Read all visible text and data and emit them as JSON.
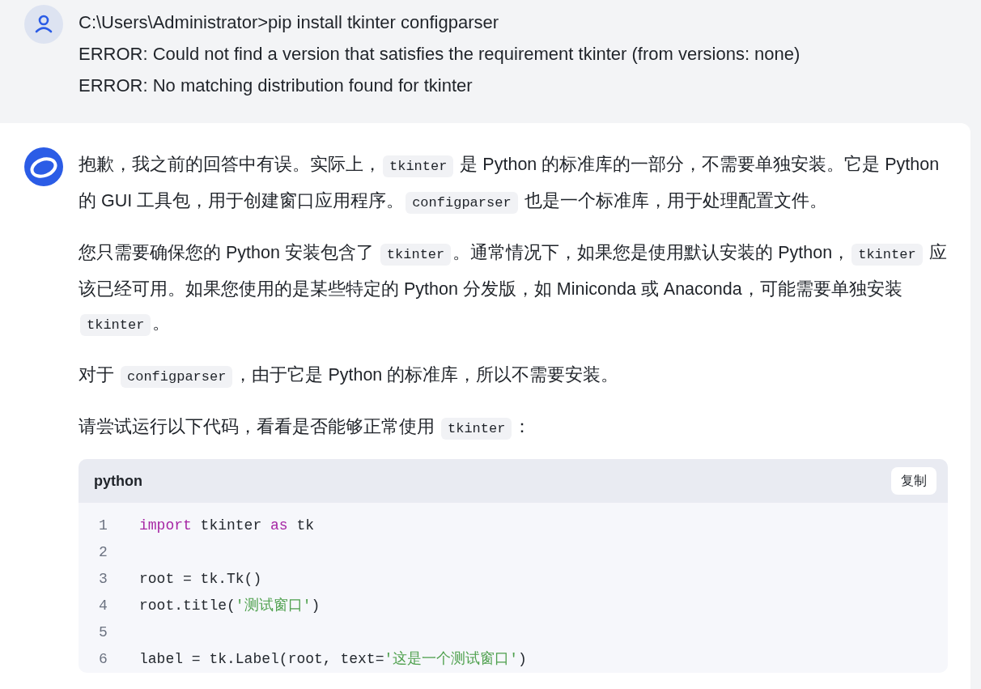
{
  "user_message": {
    "lines": [
      "C:\\Users\\Administrator>pip install tkinter configparser",
      "ERROR: Could not find a version that satisfies the requirement tkinter (from versions: none)",
      "ERROR: No matching distribution found for tkinter"
    ]
  },
  "assistant_message": {
    "paragraphs": [
      [
        {
          "kind": "text",
          "text": "抱歉，我之前的回答中有误。实际上，"
        },
        {
          "kind": "code",
          "text": "tkinter"
        },
        {
          "kind": "text",
          "text": " 是 Python 的标准库的一部分，不需要单独安装。它是 Python 的 GUI 工具包，用于创建窗口应用程序。"
        },
        {
          "kind": "code",
          "text": "configparser"
        },
        {
          "kind": "text",
          "text": " 也是一个标准库，用于处理配置文件。"
        }
      ],
      [
        {
          "kind": "text",
          "text": "您只需要确保您的 Python 安装包含了 "
        },
        {
          "kind": "code",
          "text": "tkinter"
        },
        {
          "kind": "text",
          "text": "。通常情况下，如果您是使用默认安装的 Python，"
        },
        {
          "kind": "code",
          "text": "tkinter"
        },
        {
          "kind": "text",
          "text": " 应该已经可用。如果您使用的是某些特定的 Python 分发版，如 Miniconda 或 Anaconda，可能需要单独安装 "
        },
        {
          "kind": "code",
          "text": "tkinter"
        },
        {
          "kind": "text",
          "text": "。"
        }
      ],
      [
        {
          "kind": "text",
          "text": "对于 "
        },
        {
          "kind": "code",
          "text": "configparser"
        },
        {
          "kind": "text",
          "text": "，由于它是 Python 的标准库，所以不需要安装。"
        }
      ],
      [
        {
          "kind": "text",
          "text": "请尝试运行以下代码，看看是否能够正常使用 "
        },
        {
          "kind": "code",
          "text": "tkinter"
        },
        {
          "kind": "text",
          "text": "："
        }
      ]
    ],
    "code_block": {
      "language": "python",
      "copy_button": "复制",
      "lines": [
        {
          "number": "1",
          "tokens": [
            {
              "kind": "keyword",
              "text": "import"
            },
            {
              "kind": "plain",
              "text": " tkinter "
            },
            {
              "kind": "keyword",
              "text": "as"
            },
            {
              "kind": "plain",
              "text": " tk"
            }
          ]
        },
        {
          "number": "2"
        },
        {
          "number": "3",
          "tokens": [
            {
              "kind": "plain",
              "text": "root = tk.Tk()"
            }
          ]
        },
        {
          "number": "4",
          "tokens": [
            {
              "kind": "plain",
              "text": "root.title("
            },
            {
              "kind": "string",
              "text": "'测试窗口'"
            },
            {
              "kind": "plain",
              "text": ")"
            }
          ]
        },
        {
          "number": "5"
        },
        {
          "number": "6",
          "tokens": [
            {
              "kind": "plain",
              "text": "label = tk.Label(root, text="
            },
            {
              "kind": "string",
              "text": "'这是一个测试窗口'"
            },
            {
              "kind": "plain",
              "text": ")"
            }
          ]
        }
      ]
    }
  }
}
